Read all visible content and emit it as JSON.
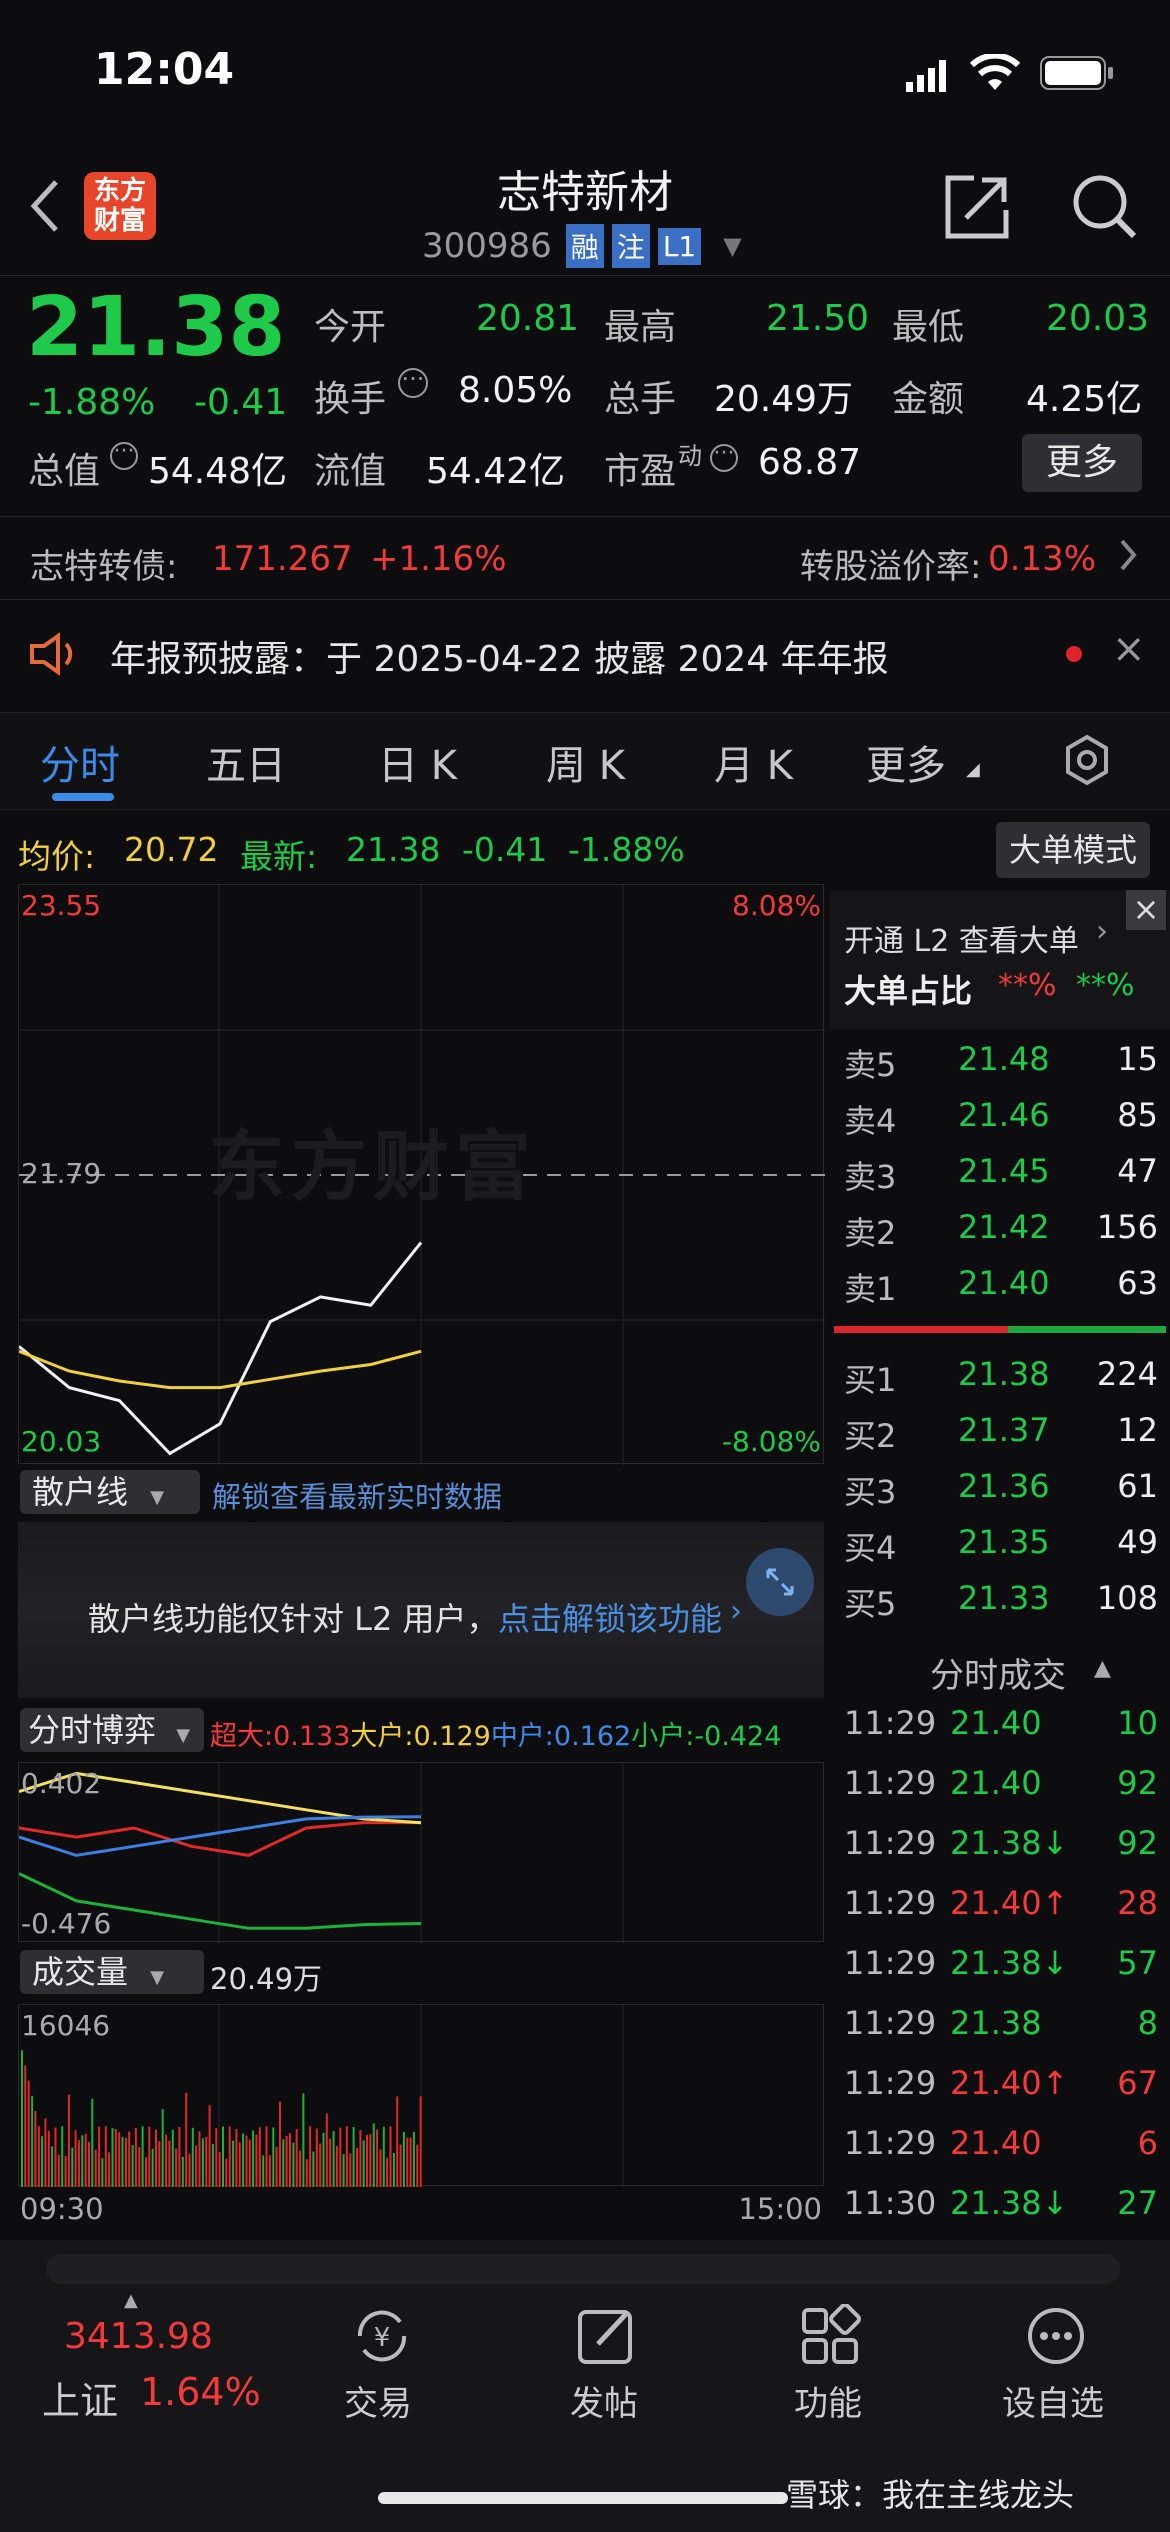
{
  "status": {
    "time": "12:04"
  },
  "nav": {
    "logo_line1": "东方",
    "logo_line2": "财富",
    "title": "志特新材",
    "code": "300986",
    "tags": [
      "融",
      "注",
      "L1"
    ]
  },
  "quote": {
    "price": "21.38",
    "pct": "-1.88%",
    "chg": "-0.41",
    "open_lbl": "今开",
    "open": "20.81",
    "high_lbl": "最高",
    "high": "21.50",
    "low_lbl": "最低",
    "low": "20.03",
    "turn_lbl": "换手",
    "turn": "8.05%",
    "vol_lbl": "总手",
    "vol": "20.49万",
    "amt_lbl": "金额",
    "amt": "4.25亿",
    "mcap_lbl": "总值",
    "mcap": "54.48亿",
    "fcap_lbl": "流值",
    "fcap": "54.42亿",
    "pe_lbl": "市盈",
    "pe_sup": "动",
    "pe": "68.87",
    "more": "更多"
  },
  "bond": {
    "name": "志特转债:",
    "price": "171.267",
    "pct": "+1.16%",
    "prem_lbl": "转股溢价率:",
    "prem": "0.13%"
  },
  "notice": {
    "text": "年报预披露：于 2025-04-22 披露 2024 年年报"
  },
  "tabs": [
    "分时",
    "五日",
    "日 K",
    "周 K",
    "月 K",
    "更多"
  ],
  "chart_info": {
    "avg_lbl": "均价:",
    "avg": "20.72",
    "last_lbl": "最新:",
    "last": "21.38",
    "chg": "-0.41",
    "pct": "-1.88%",
    "mode_btn": "大单模式"
  },
  "chart_axes": {
    "y_top": "23.55",
    "y_mid": "21.79",
    "y_bot": "20.03",
    "pct_top": "8.08%",
    "pct_bot": "-8.08%",
    "watermark": "东方财富",
    "t_start": "09:30",
    "t_end": "15:00"
  },
  "chart_data": [
    {
      "type": "line",
      "title": "",
      "x": [
        "09:30",
        "09:45",
        "10:00",
        "10:15",
        "10:30",
        "10:45",
        "11:00",
        "11:15",
        "11:29"
      ],
      "series": [
        {
          "name": "最新",
          "values": [
            20.75,
            20.5,
            20.42,
            20.1,
            20.28,
            20.9,
            21.05,
            21.0,
            21.38
          ]
        },
        {
          "name": "均价",
          "values": [
            20.72,
            20.6,
            20.54,
            20.5,
            20.5,
            20.55,
            20.6,
            20.64,
            20.72
          ]
        }
      ],
      "ylim": [
        20.03,
        23.55
      ],
      "ref_line": 21.79
    },
    {
      "type": "line",
      "title": "分时博弈",
      "series": [
        {
          "name": "超大",
          "values": [
            0.1,
            0.05,
            0.1,
            0.0,
            -0.05,
            0.1,
            0.13,
            0.13
          ]
        },
        {
          "name": "大户",
          "values": [
            0.3,
            0.4,
            0.35,
            0.3,
            0.25,
            0.2,
            0.15,
            0.129
          ]
        },
        {
          "name": "中户",
          "values": [
            0.05,
            -0.05,
            0.0,
            0.05,
            0.1,
            0.15,
            0.16,
            0.162
          ]
        },
        {
          "name": "小户",
          "values": [
            -0.15,
            -0.3,
            -0.35,
            -0.4,
            -0.45,
            -0.45,
            -0.43,
            -0.424
          ]
        }
      ],
      "ylim": [
        -0.476,
        0.402
      ]
    },
    {
      "type": "bar",
      "title": "成交量",
      "ymax": 16046
    }
  ],
  "sanhu": {
    "label": "散户线",
    "unlock": "解锁查看最新实时数据",
    "msg": "散户线功能仅针对 L2 用户，",
    "link": "点击解锁该功能"
  },
  "boyi": {
    "label": "分时博弈",
    "super_lbl": "超大:",
    "super": "0.133",
    "big_lbl": "大户:",
    "big": "0.129",
    "mid_lbl": "中户:",
    "mid": "0.162",
    "small_lbl": "小户:",
    "small": "-0.424"
  },
  "volume": {
    "label": "成交量",
    "total": "20.49万"
  },
  "l2": {
    "title": "开通 L2 查看大单",
    "ratio_lbl": "大单占比",
    "r1": "**%",
    "r2": "**%"
  },
  "asks": [
    {
      "lbl": "卖5",
      "p": "21.48",
      "v": "15"
    },
    {
      "lbl": "卖4",
      "p": "21.46",
      "v": "85"
    },
    {
      "lbl": "卖3",
      "p": "21.45",
      "v": "47"
    },
    {
      "lbl": "卖2",
      "p": "21.42",
      "v": "156"
    },
    {
      "lbl": "卖1",
      "p": "21.40",
      "v": "63"
    }
  ],
  "bids": [
    {
      "lbl": "买1",
      "p": "21.38",
      "v": "224"
    },
    {
      "lbl": "买2",
      "p": "21.37",
      "v": "12"
    },
    {
      "lbl": "买3",
      "p": "21.36",
      "v": "61"
    },
    {
      "lbl": "买4",
      "p": "21.35",
      "v": "49"
    },
    {
      "lbl": "买5",
      "p": "21.33",
      "v": "108"
    }
  ],
  "ticks_title": "分时成交",
  "ticks": [
    {
      "t": "11:29",
      "p": "21.40",
      "a": "",
      "v": "10",
      "c": "green"
    },
    {
      "t": "11:29",
      "p": "21.40",
      "a": "",
      "v": "92",
      "c": "green"
    },
    {
      "t": "11:29",
      "p": "21.38",
      "a": "↓",
      "v": "92",
      "c": "green"
    },
    {
      "t": "11:29",
      "p": "21.40",
      "a": "↑",
      "v": "28",
      "c": "red"
    },
    {
      "t": "11:29",
      "p": "21.38",
      "a": "↓",
      "v": "57",
      "c": "green"
    },
    {
      "t": "11:29",
      "p": "21.38",
      "a": "",
      "v": "8",
      "c": "green"
    },
    {
      "t": "11:29",
      "p": "21.40",
      "a": "↑",
      "v": "67",
      "c": "red"
    },
    {
      "t": "11:29",
      "p": "21.40",
      "a": "",
      "v": "6",
      "c": "red"
    },
    {
      "t": "11:30",
      "p": "21.38",
      "a": "↓",
      "v": "27",
      "c": "green"
    }
  ],
  "bottom": {
    "index_val": "3413.98",
    "index_name": "上证",
    "index_pct": "1.64%",
    "items": [
      "交易",
      "发帖",
      "功能",
      "设自选"
    ],
    "watermark": "雪球：我在主线龙头"
  }
}
